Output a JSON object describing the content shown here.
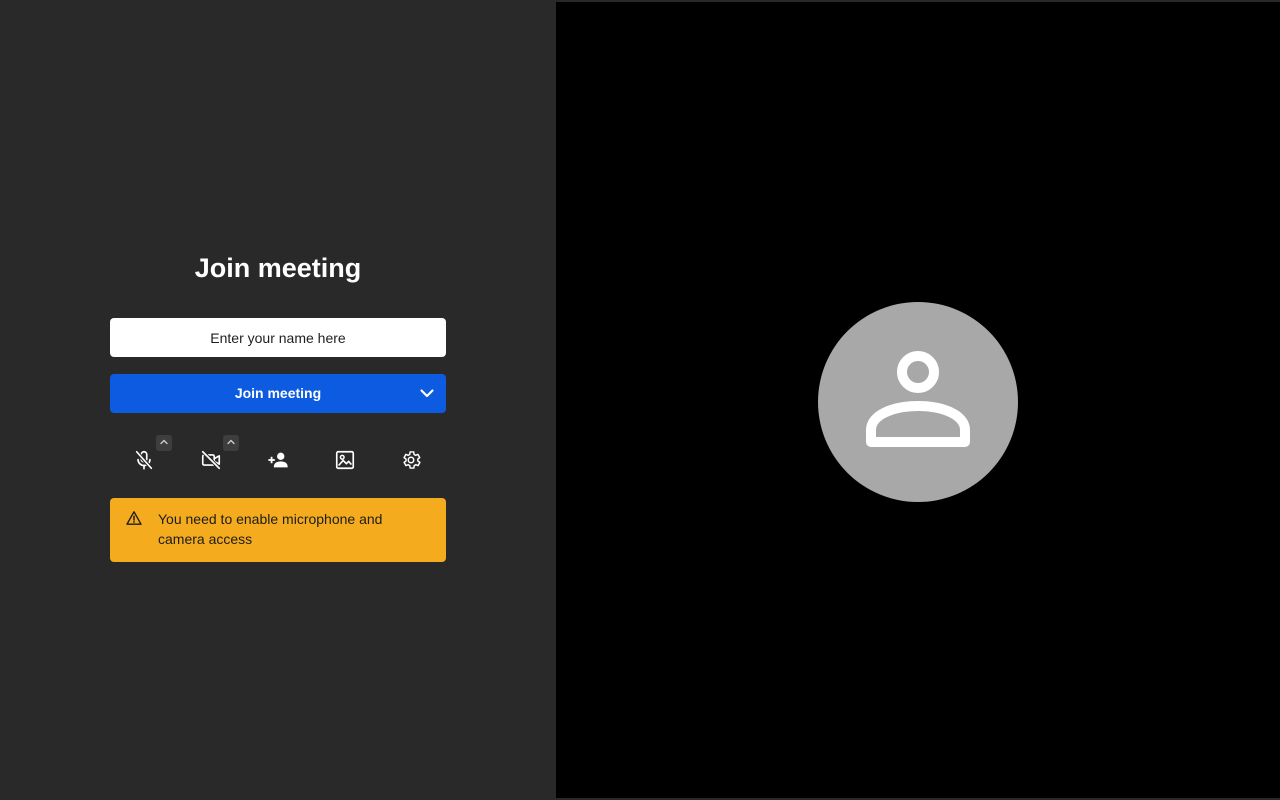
{
  "prejoin": {
    "title": "Join meeting",
    "name_input": {
      "placeholder": "Enter your name here",
      "value": ""
    },
    "join_button": {
      "label": "Join meeting"
    },
    "toolbar": [
      {
        "name": "microphone-muted",
        "icon": "mic-off-icon",
        "has_menu": true
      },
      {
        "name": "camera-off",
        "icon": "video-off-icon",
        "has_menu": true
      },
      {
        "name": "invite",
        "icon": "person-add-icon",
        "has_menu": false
      },
      {
        "name": "virtual-background",
        "icon": "image-icon",
        "has_menu": false
      },
      {
        "name": "settings",
        "icon": "gear-icon",
        "has_menu": false
      }
    ],
    "warning": {
      "icon": "warning-triangle-icon",
      "text": "You need to enable microphone and camera access"
    }
  },
  "preview": {
    "avatar_icon": "user-silhouette-icon"
  },
  "colors": {
    "left_background": "#292929",
    "right_background": "#000000",
    "primary": "#0d5be1",
    "warning": "#f5ab1e",
    "avatar": "#a8a8a8"
  }
}
